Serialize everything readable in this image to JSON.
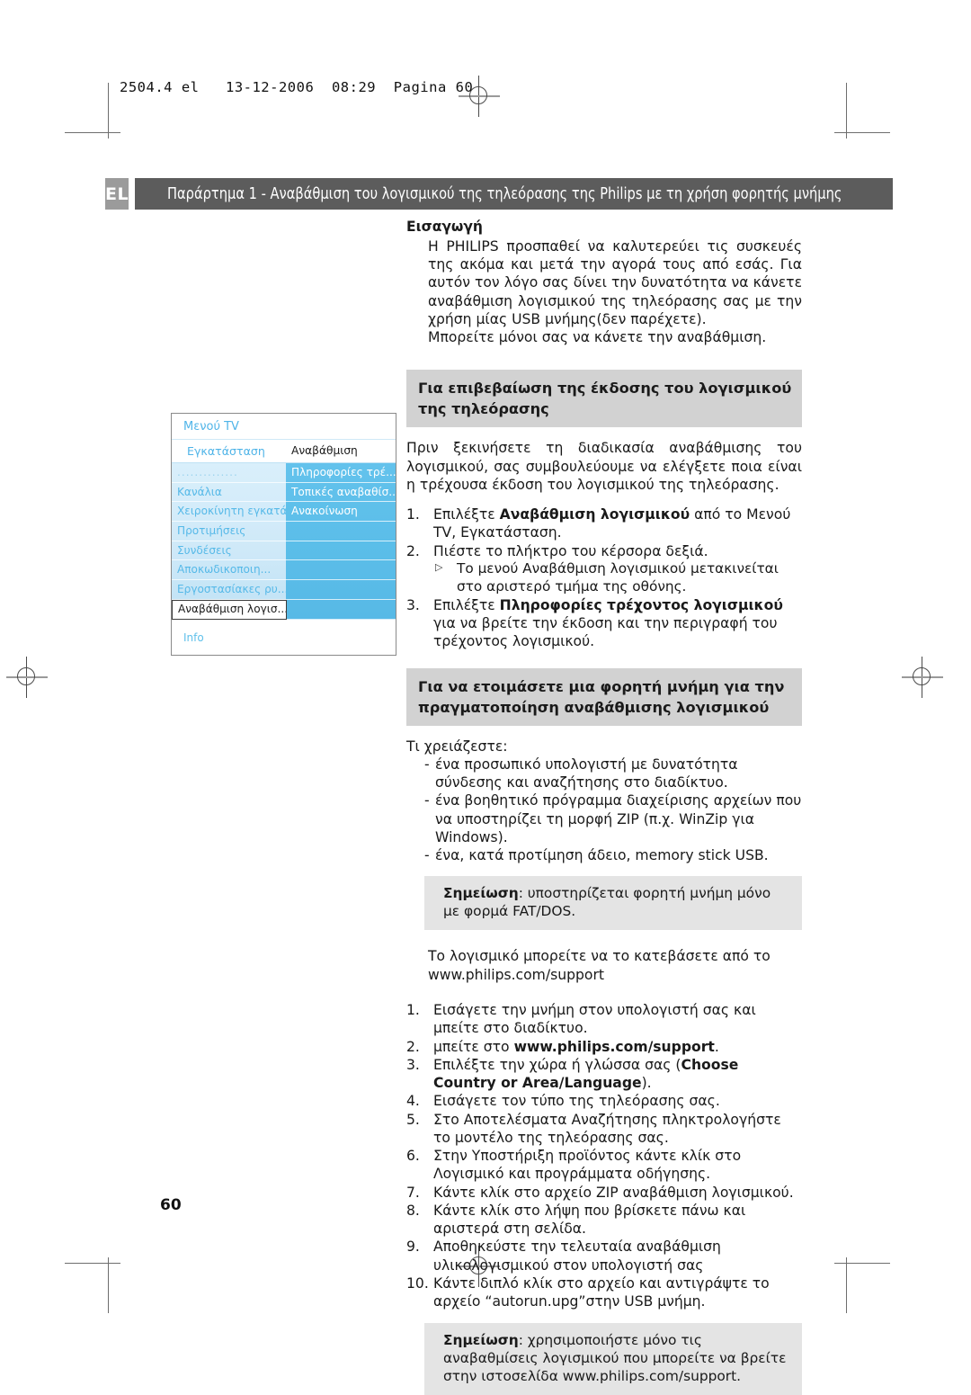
{
  "print_marks": {
    "slug": "2504.4 el   13-12-2006  08:29  Pagina 60",
    "folio": "60"
  },
  "header": {
    "language_badge": "EL",
    "title": "Παράρτημα 1 - Αναβάθμιση του λογισμικού της τηλεόρασης της Philips με τη χρήση φορητής μνήμης"
  },
  "intro": {
    "heading": "Εισαγωγή",
    "paragraph_1": "Η PHILIPS προσπαθεί να καλυτερεύει τις συσκευές της ακόμα και μετά την αγορά τους από εσάς. Για αυτόν τον λόγο σας δίνει την δυνατότητα να κάνετε αναβάθμιση λογισμικού της τηλεόρασης σας με την χρήση μίας USB μνήμης(δεν παρέχετε).",
    "paragraph_2": "Μπορείτε μόνοι σας να κάνετε την αναβάθμιση."
  },
  "section_version": {
    "heading": "Για επιβεβαίωση της έκδοσης του λογισμικού της τηλεόρασης",
    "paragraph": "Πριν ξεκινήσετε τη διαδικασία αναβάθμισης του λογισμικού, σας συμβουλεύουμε να ελέγξετε ποια είναι η τρέχουσα έκδοση του λογισμικού της τηλεόρασης.",
    "steps": [
      {
        "num": "1.",
        "pre": "Επιλέξτε ",
        "bold": "Αναβάθμιση λογισμικού",
        "post": " από το Μενού TV, Εγκατάσταση."
      },
      {
        "num": "2.",
        "pre": "Πιέστε το πλήκτρο του κέρσορα δεξιά.",
        "bold": "",
        "post": "",
        "subnote": "Το μενού Αναβάθμιση λογισμικού μετακινείται στο αριστερό τμήμα της οθόνης."
      },
      {
        "num": "3.",
        "pre": "Επιλέξτε ",
        "bold": "Πληροφορίες τρέχοντος λογισμικού",
        "post": " για να βρείτε την έκδοση και την περιγραφή του τρέχοντος λογισμικού."
      }
    ]
  },
  "tv_menu": {
    "title": "Μενού TV",
    "top_row": {
      "left": "Εγκατάσταση",
      "right": "Αναβάθμιση λογισ..."
    },
    "left_items": [
      "..............",
      "Κανάλια",
      "Χειροκίνητη εγκατά.",
      "Προτιμήσεις",
      "Συνδέσεις",
      "Αποκωδικοποιη...",
      "Εργοστασίακες ρυ...",
      "Αναβάθμιση λογισ..."
    ],
    "left_selected_index": 7,
    "right_items": [
      "Πληροφορίες τρέ...",
      "Τοπικές αναβαθίσ...",
      "Ανακοίνωση"
    ],
    "footer": "Info",
    "colors": {
      "accent_blue": "#4fb4e8",
      "panel_blue": "#5bbee9",
      "left_panel": "#cfe9f8"
    }
  },
  "section_prepare": {
    "heading": "Για να ετοιμάσετε μια φορητή μνήμη για την πραγματοποίηση αναβάθμισης λογισμικού",
    "lead": "Τι χρειάζεστε:",
    "requirements": [
      "ένα προσωπικό υπολογιστή με δυνατότητα σύνδεσης και αναζήτησης στο διαδίκτυο.",
      "ένα βοηθητικό πρόγραμμα διαχείρισης αρχείων που να υποστηρίζει τη μορφή ZIP (π.χ. WinZip για Windows).",
      "ένα, κατά προτίμηση άδειο, memory stick USB."
    ],
    "note_1": {
      "label": "Σημείωση",
      "text": ": υποστηρίζεται φορητή μνήμη μόνο με φορμά FAT/DOS."
    },
    "download_paragraph": "Το λογισμικό μπορείτε να το κατεβάσετε από το www.philips.com/support",
    "steps": [
      {
        "num": "1.",
        "pre": "Εισάγετε την μνήμη στον υπολογιστή σας και μπείτε στο διαδίκτυο.",
        "bold": "",
        "post": ""
      },
      {
        "num": "2.",
        "pre": "μπείτε στο ",
        "bold": "www.philips.com/support",
        "post": "."
      },
      {
        "num": "3.",
        "pre": "Επιλέξτε την χώρα ή γλώσσα σας (",
        "bold": "Choose Country or Area/Language",
        "post": ")."
      },
      {
        "num": "4.",
        "pre": "Εισάγετε τον τύπο της τηλεόρασης σας.",
        "bold": "",
        "post": ""
      },
      {
        "num": "5.",
        "pre": "Στο Αποτελέσματα Αναζήτησης πληκτρολογήστε το μοντέλο της τηλεόρασης σας.",
        "bold": "",
        "post": ""
      },
      {
        "num": "6.",
        "pre": "Στην Υποστήριξη προϊόντος κάντε κλίκ στο Λογισμικό και προγράμματα οδήγησης.",
        "bold": "",
        "post": ""
      },
      {
        "num": "7.",
        "pre": "Κάντε κλίκ στο  αρχείο ZIP αναβάθμιση λογισμικού.",
        "bold": "",
        "post": ""
      },
      {
        "num": "8.",
        "pre": "Κάντε κλίκ στο λήψη που βρίσκετε πάνω και αριστερά στη σελίδα.",
        "bold": "",
        "post": ""
      },
      {
        "num": "9.",
        "pre": "Αποθηκεύστε την τελευταία αναβάθμιση υλικολογισμικού στον υπολογιστή σας",
        "bold": "",
        "post": ""
      },
      {
        "num": "10.",
        "pre": "Κάντε διπλό κλίκ στο αρχείο και αντιγράψτε το αρχείο “autorun.upg”στην USB μνήμη.",
        "bold": "",
        "post": ""
      }
    ],
    "note_2": {
      "label": "Σημείωση",
      "text": ": χρησιμοποιήστε μόνο τις αναβαθμίσεις λογισμικού που μπορείτε να βρείτε στην ιστοσελίδα www.philips.com/support."
    }
  }
}
